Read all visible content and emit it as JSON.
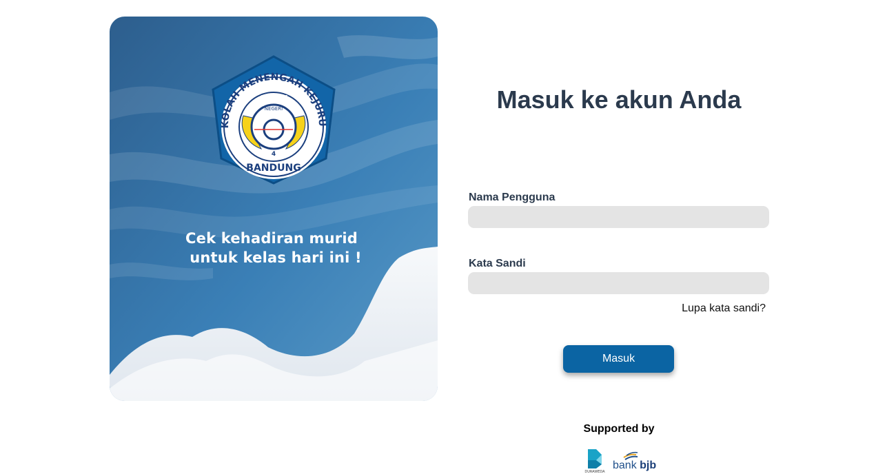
{
  "hero": {
    "logo": {
      "top_arc_text": "SEKOLAH MENENGAH KEJURUAN",
      "bottom_text": "BANDUNG",
      "center_letters": [
        "S",
        "M",
        "K"
      ],
      "center_sub": "NEGERI",
      "center_number": "4",
      "colors": {
        "outer": "#1265a8",
        "ring": "#ffffff",
        "emblem": "#f6d21b",
        "navy": "#1b3f7e"
      }
    },
    "tagline_line1": "Cek kehadiran murid",
    "tagline_line2": "untuk kelas hari ini !"
  },
  "login": {
    "title": "Masuk ke akun Anda",
    "username_label": "Nama Pengguna",
    "username_value": "",
    "password_label": "Kata Sandi",
    "password_value": "",
    "forgot_label": "Lupa kata sandi?",
    "submit_label": "Masuk"
  },
  "footer": {
    "supported_label": "Supported by",
    "sponsors": [
      {
        "name": "DURAWEDA",
        "icon": "duraweda-logo"
      },
      {
        "name_prefix": "bank",
        "name_suffix": "bjb",
        "icon": "bank-bjb-logo"
      }
    ]
  },
  "colors": {
    "accent": "#0b64a3",
    "title": "#2b3a4d",
    "field_bg": "#e4e4e4"
  }
}
